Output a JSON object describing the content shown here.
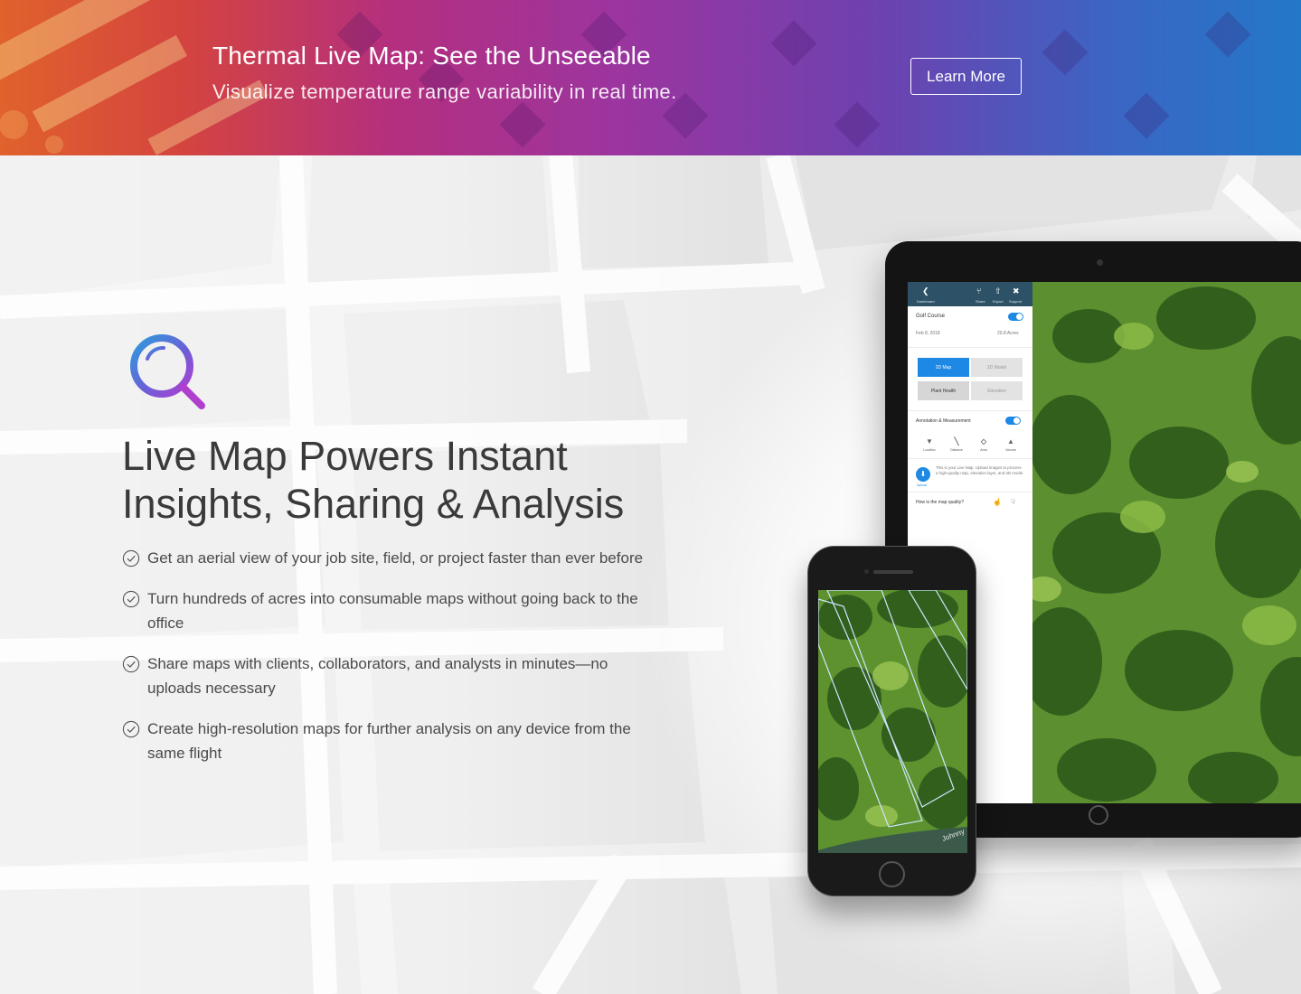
{
  "banner": {
    "title": "Thermal Live Map: See the Unseeable",
    "subtitle": "Visualize temperature range variability in real time.",
    "cta_label": "Learn More"
  },
  "hero": {
    "headline_line1": "Live Map Powers Instant",
    "headline_line2": "Insights, Sharing & Analysis",
    "bullets": [
      "Get an aerial view of your job site, field, or project faster than ever before",
      "Turn hundreds of acres into consumable maps without going back to the office",
      "Share maps with clients, collaborators, and analysts in minutes—no uploads necessary",
      "Create high-resolution maps for further analysis on any device from the same flight"
    ]
  },
  "tablet_app": {
    "header": {
      "back_label": "Dashboard",
      "share_label": "Share",
      "export_label": "Export",
      "support_label": "Support"
    },
    "project_name": "Golf Course",
    "date": "Feb 8, 2018",
    "acres": "20.8 Acres",
    "modes": [
      "2D Map",
      "3D Model",
      "Plant Health",
      "Elevation"
    ],
    "annotation_title": "Annotation & Measurement",
    "tools": [
      "Location",
      "Distance",
      "Area",
      "Volume"
    ],
    "upload_label": "Upload",
    "upload_text": "This is your Live Map. Upload images to process a high-quality map, elevation layer, and 3D model.",
    "quality_question": "How is the map quality?"
  },
  "phone_app": {
    "street_label": "Johnny"
  },
  "colors": {
    "accent_blue": "#1e88e5",
    "header_navy": "#2d5166",
    "logo_gradient_start": "#2d9cdb",
    "logo_gradient_end": "#b03fcf"
  }
}
